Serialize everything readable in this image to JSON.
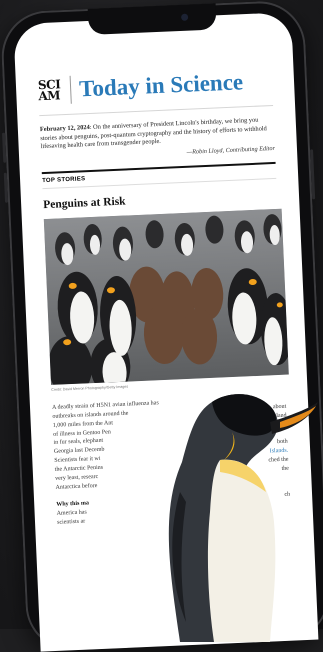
{
  "masthead": {
    "logo_lines": [
      "SCI",
      "AM"
    ],
    "title": "Today in Science"
  },
  "intro": {
    "date": "February 12, 2024",
    "text": ": On the anniversary of President Lincoln's birthday, we bring you stories about penguins, post-quantum cryptography and the history of efforts to withhold lifesaving health care from transgender people.",
    "byline": "—Robin Lloyd, Contributing Editor"
  },
  "section_label": "TOP STORIES",
  "story": {
    "headline": "Penguins at Risk",
    "photo_credit": "Credit: David Merron Photography/Getty Images",
    "paragraph_lines": [
      "A deadly strain of H5N1 avian influenza has",
      "outbreaks on islands around the",
      "1,000 miles from the Ant",
      "of illness in Gentoo Pen",
      "in fur seals, elephant",
      "Georgia last Decemb",
      "Scientists fear it wi",
      "the Antarctic Penins",
      "very least, researc",
      "Antarctica before"
    ],
    "right_fragments": [
      "ws, about",
      "Falkland",
      "both",
      "Islands.",
      "ched the",
      "the"
    ],
    "question": "Why this ma",
    "question_lines": [
      "America has",
      "scientists ar"
    ],
    "question_right": "ch"
  },
  "colors": {
    "accent": "#2a7ab8",
    "background": "#1f1f21"
  }
}
